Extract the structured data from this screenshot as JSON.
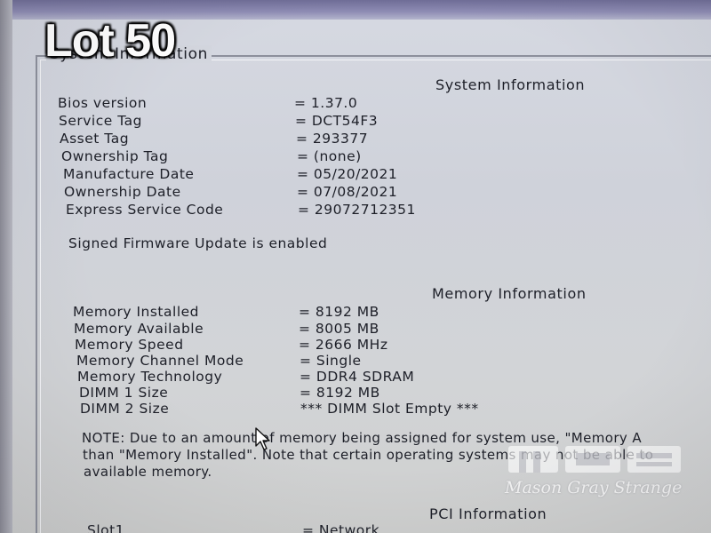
{
  "overlay": {
    "lot_label": "Lot 50",
    "watermark_text": "Mason Gray Strange"
  },
  "group": {
    "legend": "System Information"
  },
  "system_info": {
    "heading": "System Information",
    "rows": [
      {
        "label": "Bios version",
        "value": "= 1.37.0"
      },
      {
        "label": "Service Tag",
        "value": "= DCT54F3"
      },
      {
        "label": "Asset Tag",
        "value": "= 293377"
      },
      {
        "label": "Ownership Tag",
        "value": "= (none)"
      },
      {
        "label": "Manufacture Date",
        "value": "= 05/20/2021"
      },
      {
        "label": "Ownership Date",
        "value": "= 07/08/2021"
      },
      {
        "label": "Express Service Code",
        "value": "= 29072712351"
      }
    ],
    "firmware_note": "Signed Firmware Update is enabled"
  },
  "memory_info": {
    "heading": "Memory Information",
    "rows": [
      {
        "label": "Memory Installed",
        "value": "= 8192 MB"
      },
      {
        "label": "Memory Available",
        "value": "= 8005 MB"
      },
      {
        "label": "Memory Speed",
        "value": "= 2666 MHz"
      },
      {
        "label": "Memory Channel Mode",
        "value": "= Single"
      },
      {
        "label": "Memory Technology",
        "value": "= DDR4 SDRAM"
      },
      {
        "label": "DIMM 1 Size",
        "value": "= 8192 MB"
      },
      {
        "label": "DIMM 2 Size",
        "value": "*** DIMM Slot Empty ***"
      }
    ],
    "note_lines": [
      "NOTE: Due to an amount of memory being assigned for system use, \"Memory A",
      "than \"Memory Installed\". Note that certain operating systems may not be able to",
      "available memory."
    ]
  },
  "pci_info": {
    "heading": "PCI Information",
    "rows": [
      {
        "label": "Slot1",
        "value": "= Network"
      }
    ]
  },
  "colors": {
    "background": "#d3d6de",
    "text": "#1d1f28",
    "frame_line": "#8d909c"
  }
}
